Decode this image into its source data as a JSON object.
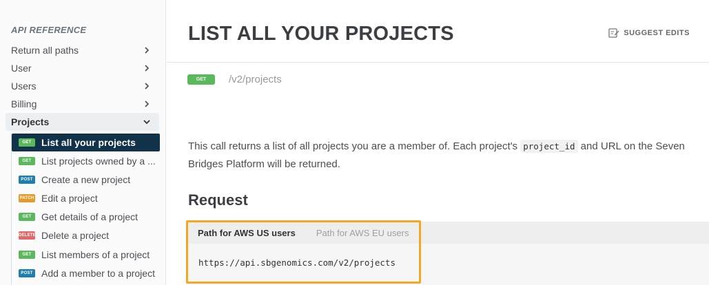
{
  "sidebar": {
    "heading": "API REFERENCE",
    "items": [
      {
        "label": "Return all paths"
      },
      {
        "label": "User"
      },
      {
        "label": "Users"
      },
      {
        "label": "Billing"
      },
      {
        "label": "Projects"
      }
    ],
    "sub_items": [
      {
        "method": "GET",
        "label": "List all your projects"
      },
      {
        "method": "GET",
        "label": "List projects owned by a ..."
      },
      {
        "method": "POST",
        "label": "Create a new project"
      },
      {
        "method": "PATCH",
        "label": "Edit a project"
      },
      {
        "method": "GET",
        "label": "Get details of a project"
      },
      {
        "method": "DELETE",
        "label": "Delete a project"
      },
      {
        "method": "GET",
        "label": "List members of a project"
      },
      {
        "method": "POST",
        "label": "Add a member to a project"
      }
    ]
  },
  "main": {
    "title": "LIST ALL YOUR PROJECTS",
    "suggest_edits": "SUGGEST EDITS",
    "method": "GET",
    "path": "/v2/projects",
    "description_before": "This call returns a list of all projects you are a member of. Each project's ",
    "description_code": "project_id",
    "description_after": " and URL on the Seven Bridges Platform will be returned.",
    "request_heading": "Request",
    "code_tabs": [
      "Path for AWS US users",
      "Path for AWS EU users"
    ],
    "code_text": "https://api.sbgenomics.com/v2/projects"
  },
  "colors": {
    "get": "#5cb85c",
    "post": "#1f7fb1",
    "patch": "#e59a2b",
    "delete": "#e06a6a",
    "active_nav": "#12324a",
    "highlight": "#f5a623"
  }
}
